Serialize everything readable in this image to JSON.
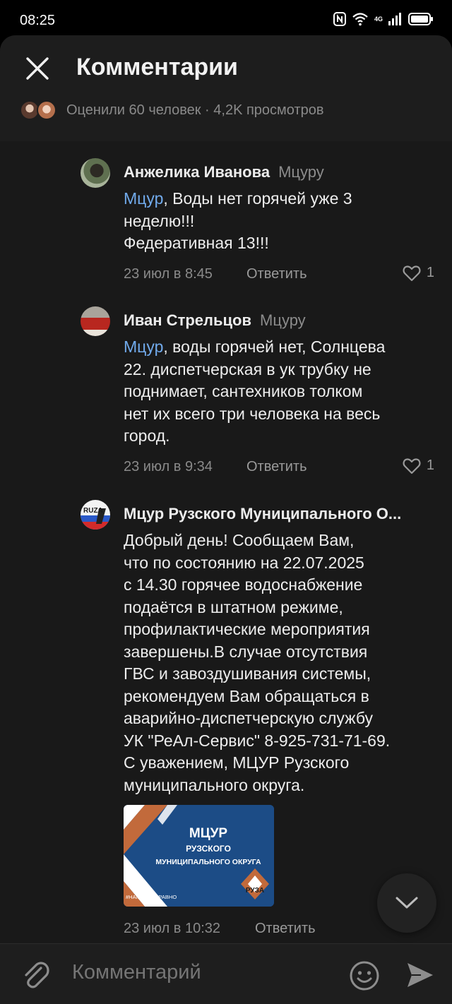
{
  "status": {
    "time": "08:25",
    "network": "4G"
  },
  "header": {
    "title": "Комментарии",
    "stats": "Оценили 60 человек · 4,2K просмотров"
  },
  "comments": [
    {
      "author": "Анжелика Иванова",
      "reply_to": "Мцуру",
      "mention": "Мцур",
      "text_lines": [
        ", Воды нет горячей уже 3",
        "неделю!!!",
        "Федеративная 13!!!"
      ],
      "date": "23 июл в 8:45",
      "reply_label": "Ответить",
      "likes": "1"
    },
    {
      "author": "Иван Стрельцов",
      "reply_to": "Мцуру",
      "mention": "Мцур",
      "text_lines": [
        ", воды горячей нет, Солнцева",
        "22. диспетчерская в ук трубку не",
        "поднимает, сантехников толком",
        "нет их всего три человека на весь",
        "город."
      ],
      "date": "23 июл в 9:34",
      "reply_label": "Ответить",
      "likes": "1"
    },
    {
      "author": "Мцур Рузского Муниципального О...",
      "avatar_text": "RUZA",
      "text_lines": [
        "Добрый день! Сообщаем Вам,",
        "что по состоянию на 22.07.2025",
        "с 14.30 горячее водоснабжение",
        "подаётся в штатном режиме,",
        "профилактические мероприятия",
        "завершены.В случае отсутствия",
        "ГВС и завоздушивания системы,",
        "рекомендуем Вам обращаться в",
        "аварийно-диспетчерскую службу",
        "УК  \"РеАл-Сервис\" 8-925-731-71-69.",
        "С уважением, МЦУР Рузского",
        "муниципального округа."
      ],
      "attachment": {
        "line1": "МЦУР",
        "line2": "РУЗСКОГО",
        "line3": "МУНИЦИПАЛЬНОГО ОКРУГА",
        "hashtag": "#НАМНЕВСЕРАВНО",
        "logo_text": "РУЗА"
      },
      "date": "23 июл в 10:32",
      "reply_label": "Ответить"
    }
  ],
  "composer": {
    "placeholder": "Комментарий"
  },
  "colors": {
    "background": "#191919",
    "mention": "#71aaeb",
    "muted": "#8a8a8a",
    "attachment_bg": "#1c4c86"
  },
  "icons": [
    "close-icon",
    "heart-icon",
    "chevron-down-icon",
    "paperclip-icon",
    "emoji-icon",
    "send-icon"
  ]
}
